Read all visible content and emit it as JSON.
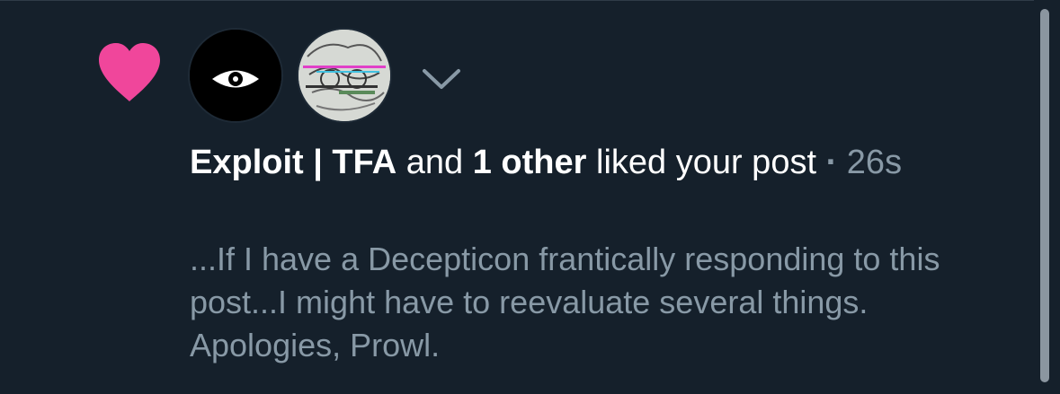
{
  "notification": {
    "type_icon": "heart-icon",
    "accent_color": "#f0469b",
    "avatars": [
      {
        "icon": "eye-logo-icon"
      },
      {
        "icon": "sketch-glitch-avatar"
      }
    ],
    "expand_icon": "chevron-down-icon",
    "actor_name": "Exploit | TFA",
    "connector": " and ",
    "others": "1 other",
    "action": " liked your post",
    "separator": " · ",
    "time": "26s",
    "excerpt": "...If I have a Decepticon frantically responding to this post...I might have to reevaluate several things. Apologies, Prowl."
  }
}
